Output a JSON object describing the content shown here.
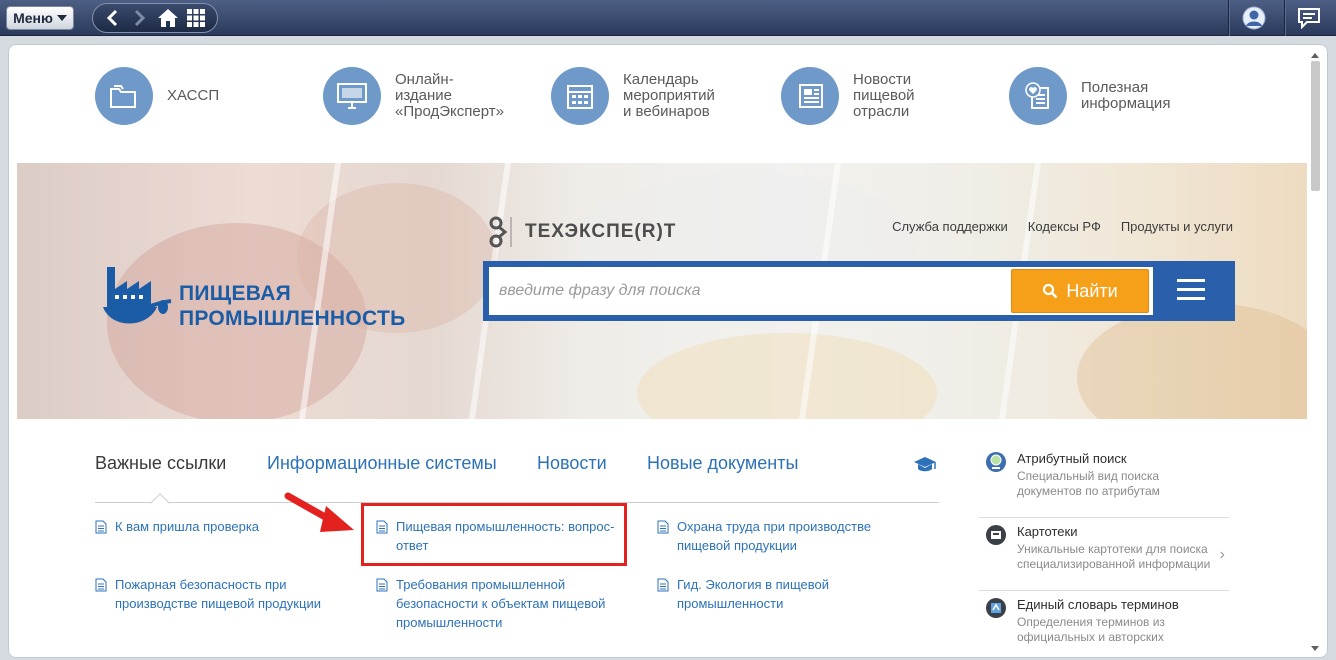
{
  "topbar": {
    "menu_label": "Меню",
    "icons": [
      "back-icon",
      "forward-icon",
      "home-icon",
      "apps-grid-icon",
      "user-icon",
      "chat-icon"
    ]
  },
  "categories": [
    {
      "label": "ХАССП",
      "icon": "folders-icon"
    },
    {
      "label": "Онлайн-издание\n«ПродЭксперт»",
      "icon": "monitor-icon"
    },
    {
      "label": "Календарь\nмероприятий\nи вебинаров",
      "icon": "calendar-icon"
    },
    {
      "label": "Новости пищевой\nотрасли",
      "icon": "newspaper-icon"
    },
    {
      "label": "Полезная\nинформация",
      "icon": "heart-document-icon"
    }
  ],
  "banner": {
    "logo_text_1": "ПИЩЕВАЯ",
    "logo_text_2": "ПРОМЫШЛЕННОСТЬ",
    "brand": "ТЕХЭКСПЕ(R)Т",
    "top_links": [
      "Служба поддержки",
      "Кодексы РФ",
      "Продукты и услуги"
    ],
    "search_placeholder": "введите фразу для поиска",
    "search_button": "Найти"
  },
  "tabs": [
    {
      "label": "Важные ссылки",
      "active": true
    },
    {
      "label": "Информационные системы",
      "active": false
    },
    {
      "label": "Новости",
      "active": false
    },
    {
      "label": "Новые документы",
      "active": false
    }
  ],
  "links": {
    "col1": [
      "К вам пришла проверка",
      "Пожарная безопасность при\nпроизводстве пищевой продукции"
    ],
    "col2": [
      "Пищевая промышленность: вопрос-\nответ",
      "Требования промышленной\nбезопасности к объектам пищевой\nпромышленности"
    ],
    "col3": [
      "Охрана труда при производстве\nпищевой продукции",
      "Гид. Экология в пищевой\nпромышленности"
    ]
  },
  "side": [
    {
      "title": "Атрибутный поиск",
      "desc": "Специальный вид поиска\nдокументов по атрибутам",
      "icon": "attribute-search-icon"
    },
    {
      "title": "Картотеки",
      "desc": "Уникальные картотеки для поиска\nспециализированной информации",
      "icon": "card-index-icon"
    },
    {
      "title": "Единый словарь терминов",
      "desc": "Определения терминов из\nофициальных и авторских",
      "icon": "dictionary-icon"
    }
  ],
  "colors": {
    "accent": "#2a60ab",
    "button": "#f6a01a",
    "highlight": "#e3221f",
    "link": "#2d72b8"
  }
}
